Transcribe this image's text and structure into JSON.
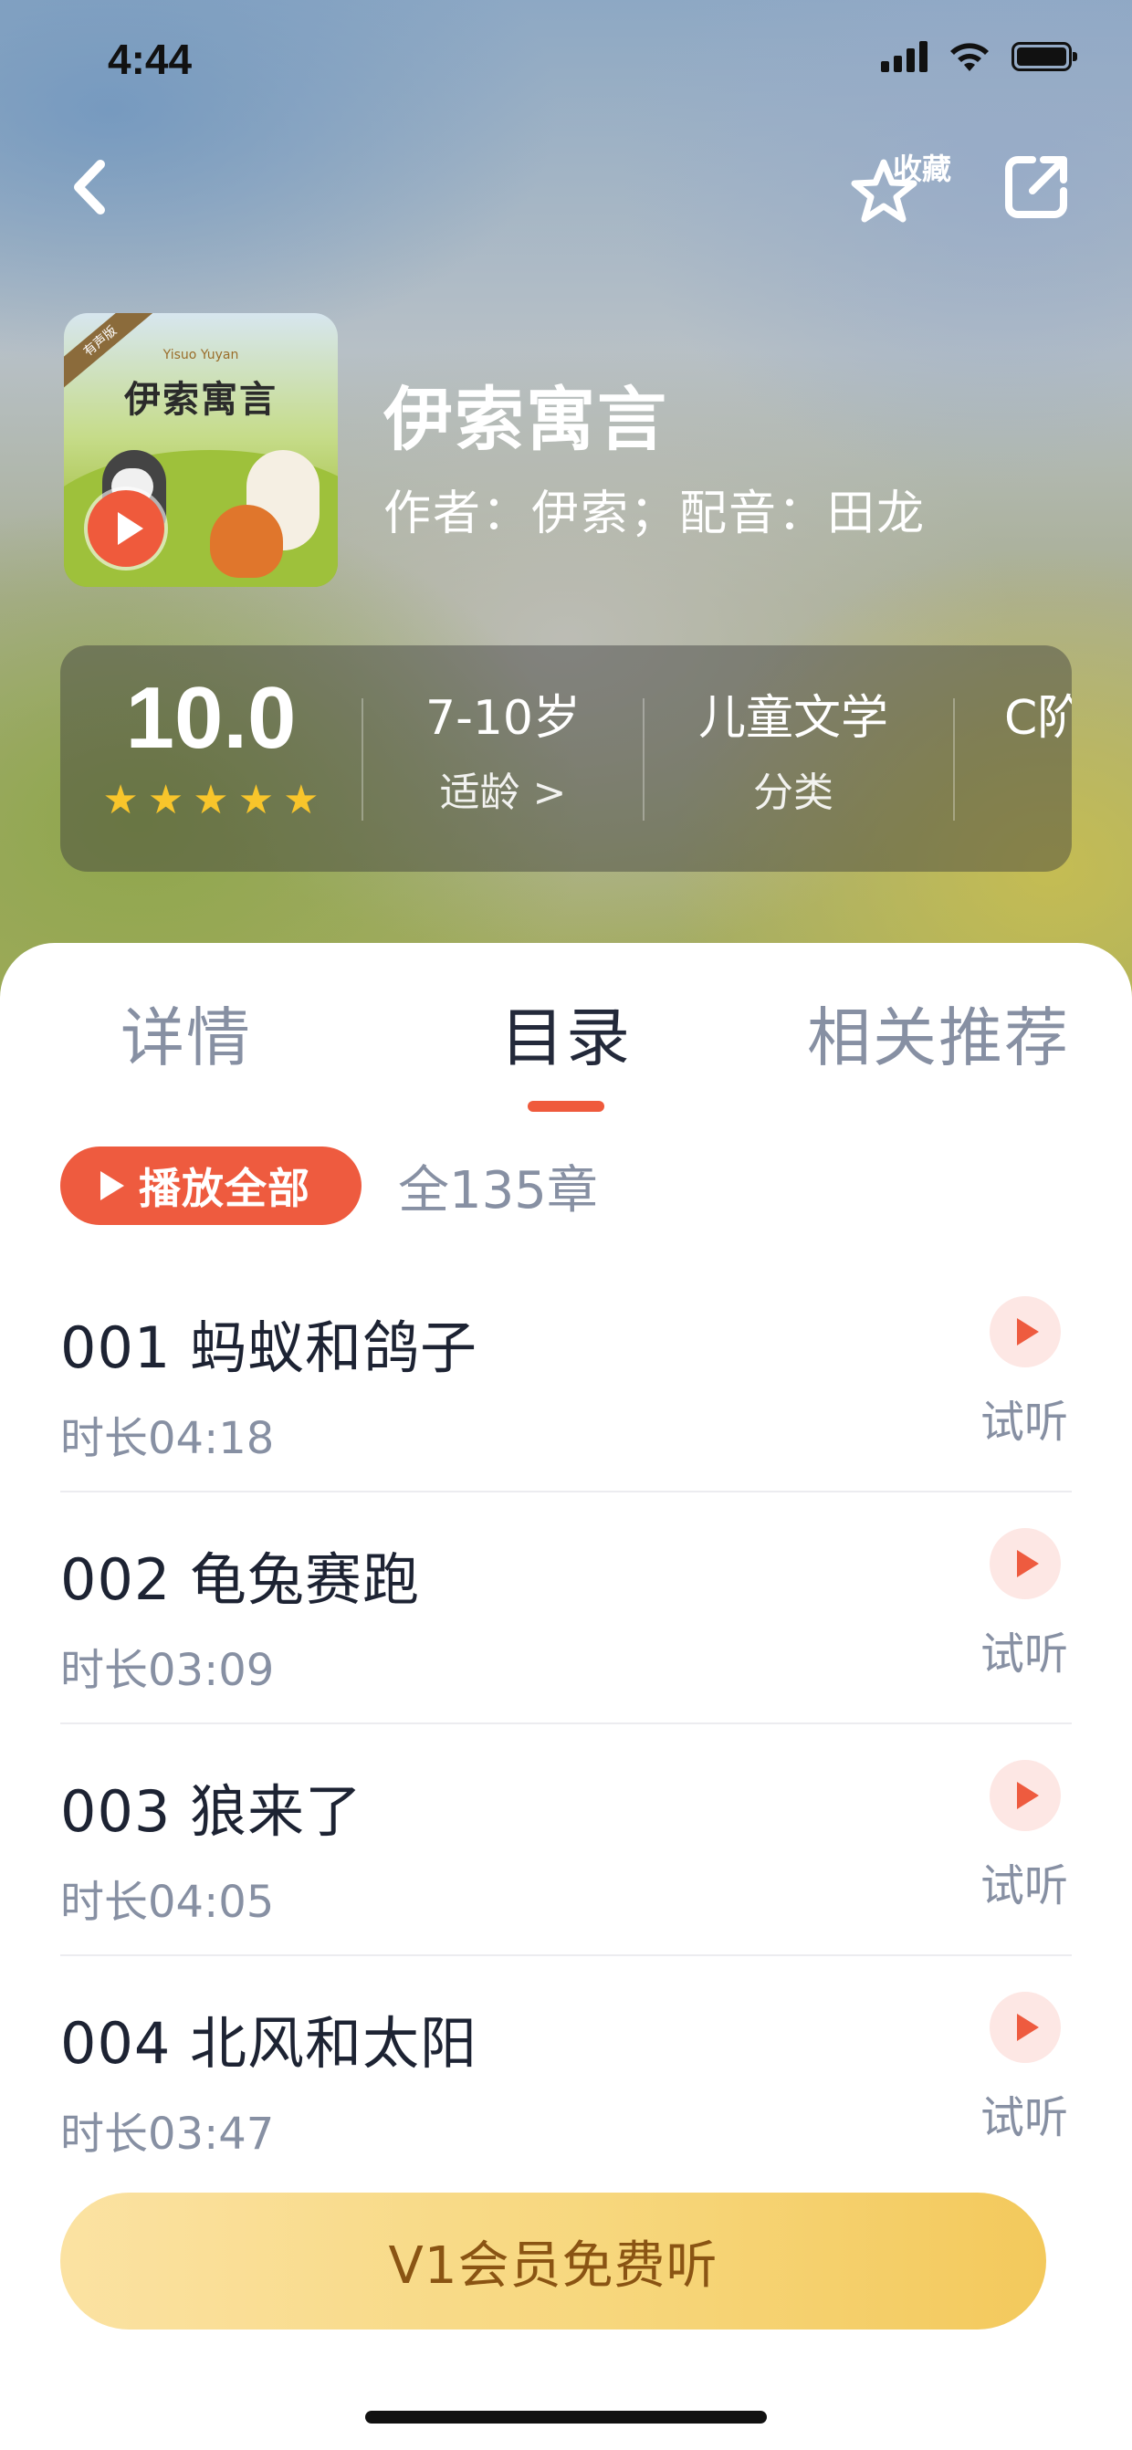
{
  "status_bar": {
    "time": "4:44",
    "icons": [
      "signal-icon",
      "wifi-icon",
      "battery-icon"
    ]
  },
  "nav": {
    "back_icon": "chevron-left-icon",
    "favorite_label": "收藏",
    "favorite_icon": "star-outline-icon",
    "share_icon": "share-icon"
  },
  "book": {
    "cover_title": "伊索寓言",
    "cover_pinyin": "Yisuo Yuyan",
    "cover_badge": "有声版",
    "title": "伊索寓言",
    "meta": "作者：伊索；配音：田龙"
  },
  "stats": {
    "score": "10.0",
    "stars": 5,
    "age_value": "7-10岁",
    "age_label": "适龄 >",
    "category_value": "儿童文学",
    "category_label": "分类",
    "level_value": "C阶"
  },
  "tabs": [
    {
      "label": "详情",
      "active": false
    },
    {
      "label": "目录",
      "active": true
    },
    {
      "label": "相关推荐",
      "active": false
    }
  ],
  "toolbar": {
    "play_all_label": "播放全部",
    "chapter_count": "全135章"
  },
  "chapters": [
    {
      "title": "001 蚂蚁和鸽子",
      "duration": "时长04:18",
      "try_label": "试听"
    },
    {
      "title": "002 龟兔赛跑",
      "duration": "时长03:09",
      "try_label": "试听"
    },
    {
      "title": "003 狼来了",
      "duration": "时长04:05",
      "try_label": "试听"
    },
    {
      "title": "004 北风和太阳",
      "duration": "时长03:47",
      "try_label": "试听"
    }
  ],
  "vip_button_label": "V1会员免费听",
  "colors": {
    "accent": "#EE5B3F",
    "vip_gold": "#F7D77D",
    "text_primary": "#1D2333",
    "text_secondary": "#8790A3"
  }
}
